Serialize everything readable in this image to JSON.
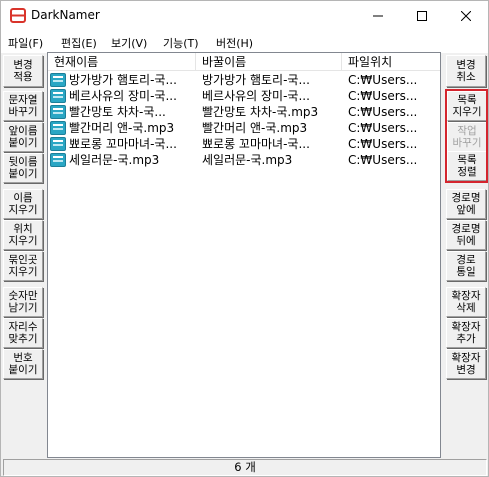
{
  "window": {
    "title": "DarkNamer"
  },
  "menu": [
    "파일(F)",
    "편집(E)",
    "보기(V)",
    "기능(T)",
    "버전(H)"
  ],
  "left_buttons": [
    "변경\n적용",
    "문자열\n바꾸기",
    "앞이름\n붙이기",
    "뒷이름\n붙이기",
    "이름\n지우기",
    "위치\n지우기",
    "묶인곳\n지우기",
    "숫자만\n남기기",
    "자리수\n맞추기",
    "번호\n붙이기"
  ],
  "right_buttons": [
    {
      "label": "변경\n취소",
      "enabled": true
    },
    {
      "label": "목록\n지우기",
      "enabled": true
    },
    {
      "label": "작업\n바꾸기",
      "enabled": false
    },
    {
      "label": "목록\n정렬",
      "enabled": true
    },
    {
      "label": "경로명\n앞에",
      "enabled": true
    },
    {
      "label": "경로명\n뒤에",
      "enabled": true
    },
    {
      "label": "경로\n통일",
      "enabled": true
    },
    {
      "label": "확장자\n삭제",
      "enabled": true
    },
    {
      "label": "확장자\n추가",
      "enabled": true
    },
    {
      "label": "확장자\n변경",
      "enabled": true
    }
  ],
  "list": {
    "columns": [
      "현재이름",
      "바꿀이름",
      "파일위치"
    ],
    "rows": [
      [
        "방가방가 햄토리-국...",
        "방가방가 햄토리-국...",
        "C:₩Users..."
      ],
      [
        "베르사유의 장미-국...",
        "베르사유의 장미-국...",
        "C:₩Users..."
      ],
      [
        "빨간망토 차차-국...",
        "빨간망토 차차-국.mp3",
        "C:₩Users..."
      ],
      [
        "빨간머리 앤-국.mp3",
        "빨간머리 앤-국.mp3",
        "C:₩Users..."
      ],
      [
        "뾰로롱 꼬마마녀-국...",
        "뾰로롱 꼬마마녀-국...",
        "C:₩Users..."
      ],
      [
        "세일러문-국.mp3",
        "세일러문-국.mp3",
        "C:₩Users..."
      ]
    ]
  },
  "status": {
    "count": "6 개"
  },
  "colors": {
    "highlight": "#d4252e",
    "icon_teal": "#2aa6c4",
    "app_icon_red": "#d9342b"
  },
  "icons": {
    "file": "audio-file-icon",
    "app": "darknamer-app-icon"
  }
}
